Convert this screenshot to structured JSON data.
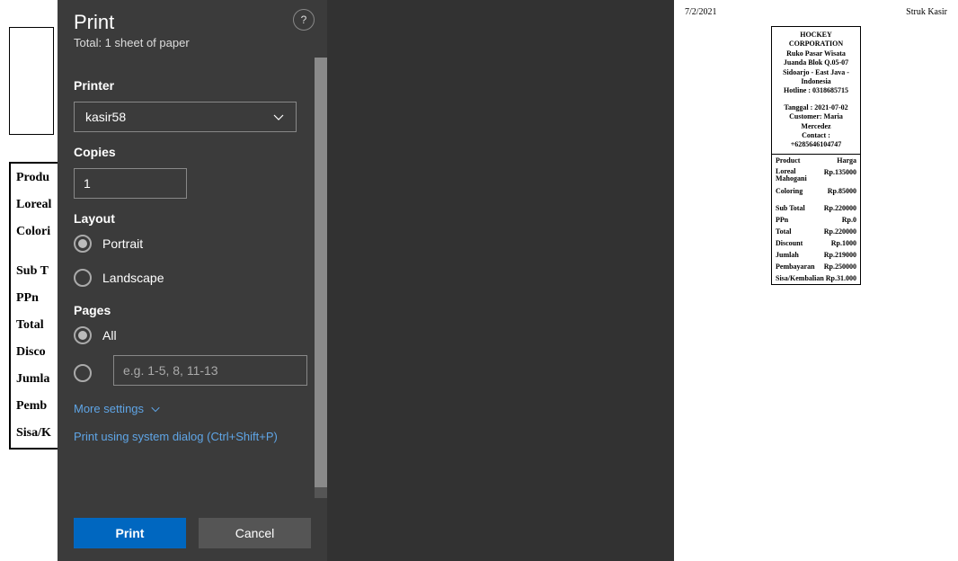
{
  "dialog": {
    "title": "Print",
    "subtitle": "Total: 1 sheet of paper",
    "help_tooltip": "?",
    "printer": {
      "label": "Printer",
      "value": "kasir58"
    },
    "copies": {
      "label": "Copies",
      "value": "1"
    },
    "layout": {
      "label": "Layout",
      "portrait": "Portrait",
      "landscape": "Landscape",
      "selected": "portrait"
    },
    "pages": {
      "label": "Pages",
      "all": "All",
      "range_placeholder": "e.g. 1-5, 8, 11-13",
      "selected": "all"
    },
    "more_settings": "More settings",
    "system_dialog": "Print using system dialog (Ctrl+Shift+P)",
    "print_btn": "Print",
    "cancel_btn": "Cancel"
  },
  "bg_page": {
    "rows": [
      "Produ",
      "Loreal",
      "Colori",
      "Sub T",
      "PPn",
      "Total",
      "Disco",
      "Jumla",
      "Pemb",
      "Sisa/K"
    ]
  },
  "preview": {
    "header_left": "7/2/2021",
    "header_right": "Struk Kasir",
    "company": [
      "HOCKEY",
      "CORPORATION"
    ],
    "address": [
      "Ruko Pasar Wisata",
      "Juanda Blok Q.05-07",
      "Sidoarjo - East Java -",
      "Indonesia"
    ],
    "hotline": "Hotline : 0318685715",
    "tanggal": "Tanggal : 2021-07-02",
    "customer": [
      "Customer: Maria",
      "Mercedez"
    ],
    "contact_label": "Contact :",
    "contact_number": "+6285646104747",
    "table_head": {
      "product": "Product",
      "harga": "Harga"
    },
    "items": [
      {
        "name": "Loreal Mahogani",
        "price": "Rp.135000"
      },
      {
        "name": "Coloring",
        "price": "Rp.85000"
      }
    ],
    "summary": [
      {
        "label": "Sub Total",
        "value": "Rp.220000"
      },
      {
        "label": "PPn",
        "value": "Rp.0"
      },
      {
        "label": "Total",
        "value": "Rp.220000"
      },
      {
        "label": "Discount",
        "value": "Rp.1000"
      },
      {
        "label": "Jumlah",
        "value": "Rp.219000"
      },
      {
        "label": "Pembayaran",
        "value": "Rp.250000"
      },
      {
        "label": "Sisa/Kembalian",
        "value": "Rp.31.000"
      }
    ]
  }
}
